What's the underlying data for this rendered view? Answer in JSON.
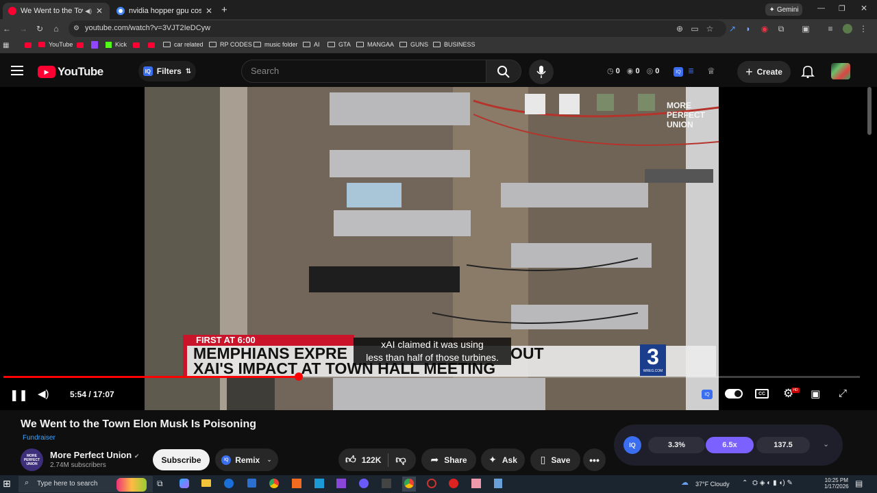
{
  "browser": {
    "tabs": [
      {
        "title": "We Went to the Town Elon",
        "active": true
      },
      {
        "title": "nvidia hopper gpu cost - Goog",
        "active": false
      }
    ],
    "gemini_label": "Gemini",
    "url": "youtube.com/watch?v=3VJT2IeDCyw"
  },
  "bookmarks": [
    {
      "label": "YouTube",
      "type": "youtube"
    },
    {
      "label": "Kick",
      "type": "kick"
    },
    {
      "label": "car related",
      "type": "folder"
    },
    {
      "label": "RP CODES",
      "type": "folder"
    },
    {
      "label": "music folder",
      "type": "folder"
    },
    {
      "label": "AI",
      "type": "folder"
    },
    {
      "label": "GTA",
      "type": "folder"
    },
    {
      "label": "MANGAA",
      "type": "folder"
    },
    {
      "label": "GUNS",
      "type": "folder"
    },
    {
      "label": "BUSINESS",
      "type": "folder"
    }
  ],
  "youtube": {
    "logo_text": "YouTube",
    "filters_label": "Filters",
    "search_placeholder": "Search",
    "stats": [
      "0",
      "0",
      "0"
    ],
    "create_label": "Create"
  },
  "player": {
    "time": "5:54 / 17:07",
    "progress": 0.3447,
    "watermark": "MORE PERFECT UNION",
    "news_kicker": "FIRST AT 6:00",
    "news_headline_1": "MEMPHIANS EXPRE",
    "news_headline_1_tail": "OUT",
    "news_headline_2": "XAI'S IMPACT AT TOWN HALL MEETING",
    "caption_line_1": "xAI claimed it was using",
    "caption_line_2": "less than half of those turbines.",
    "channel_logo_num": "3",
    "channel_logo_sub": "WREG.COM"
  },
  "video": {
    "title": "We Went to the Town Elon Musk Is Poisoning",
    "badge": "Fundraiser",
    "channel": "More Perfect Union",
    "subscribers": "2.74M subscribers",
    "subscribe_label": "Subscribe",
    "remix_label": "Remix",
    "likes": "122K",
    "share_label": "Share",
    "ask_label": "Ask",
    "save_label": "Save"
  },
  "extension_panel": {
    "values": [
      "3.3%",
      "6.5x",
      "137.5"
    ]
  },
  "taskbar": {
    "search_placeholder": "Type here to search",
    "weather": "37°F  Cloudy",
    "time": "10:25 PM",
    "date": "1/17/2026"
  },
  "colors": {
    "youtube_red": "#ff0033",
    "accent_purple": "#7b61ff",
    "link_blue": "#3ea6ff"
  }
}
